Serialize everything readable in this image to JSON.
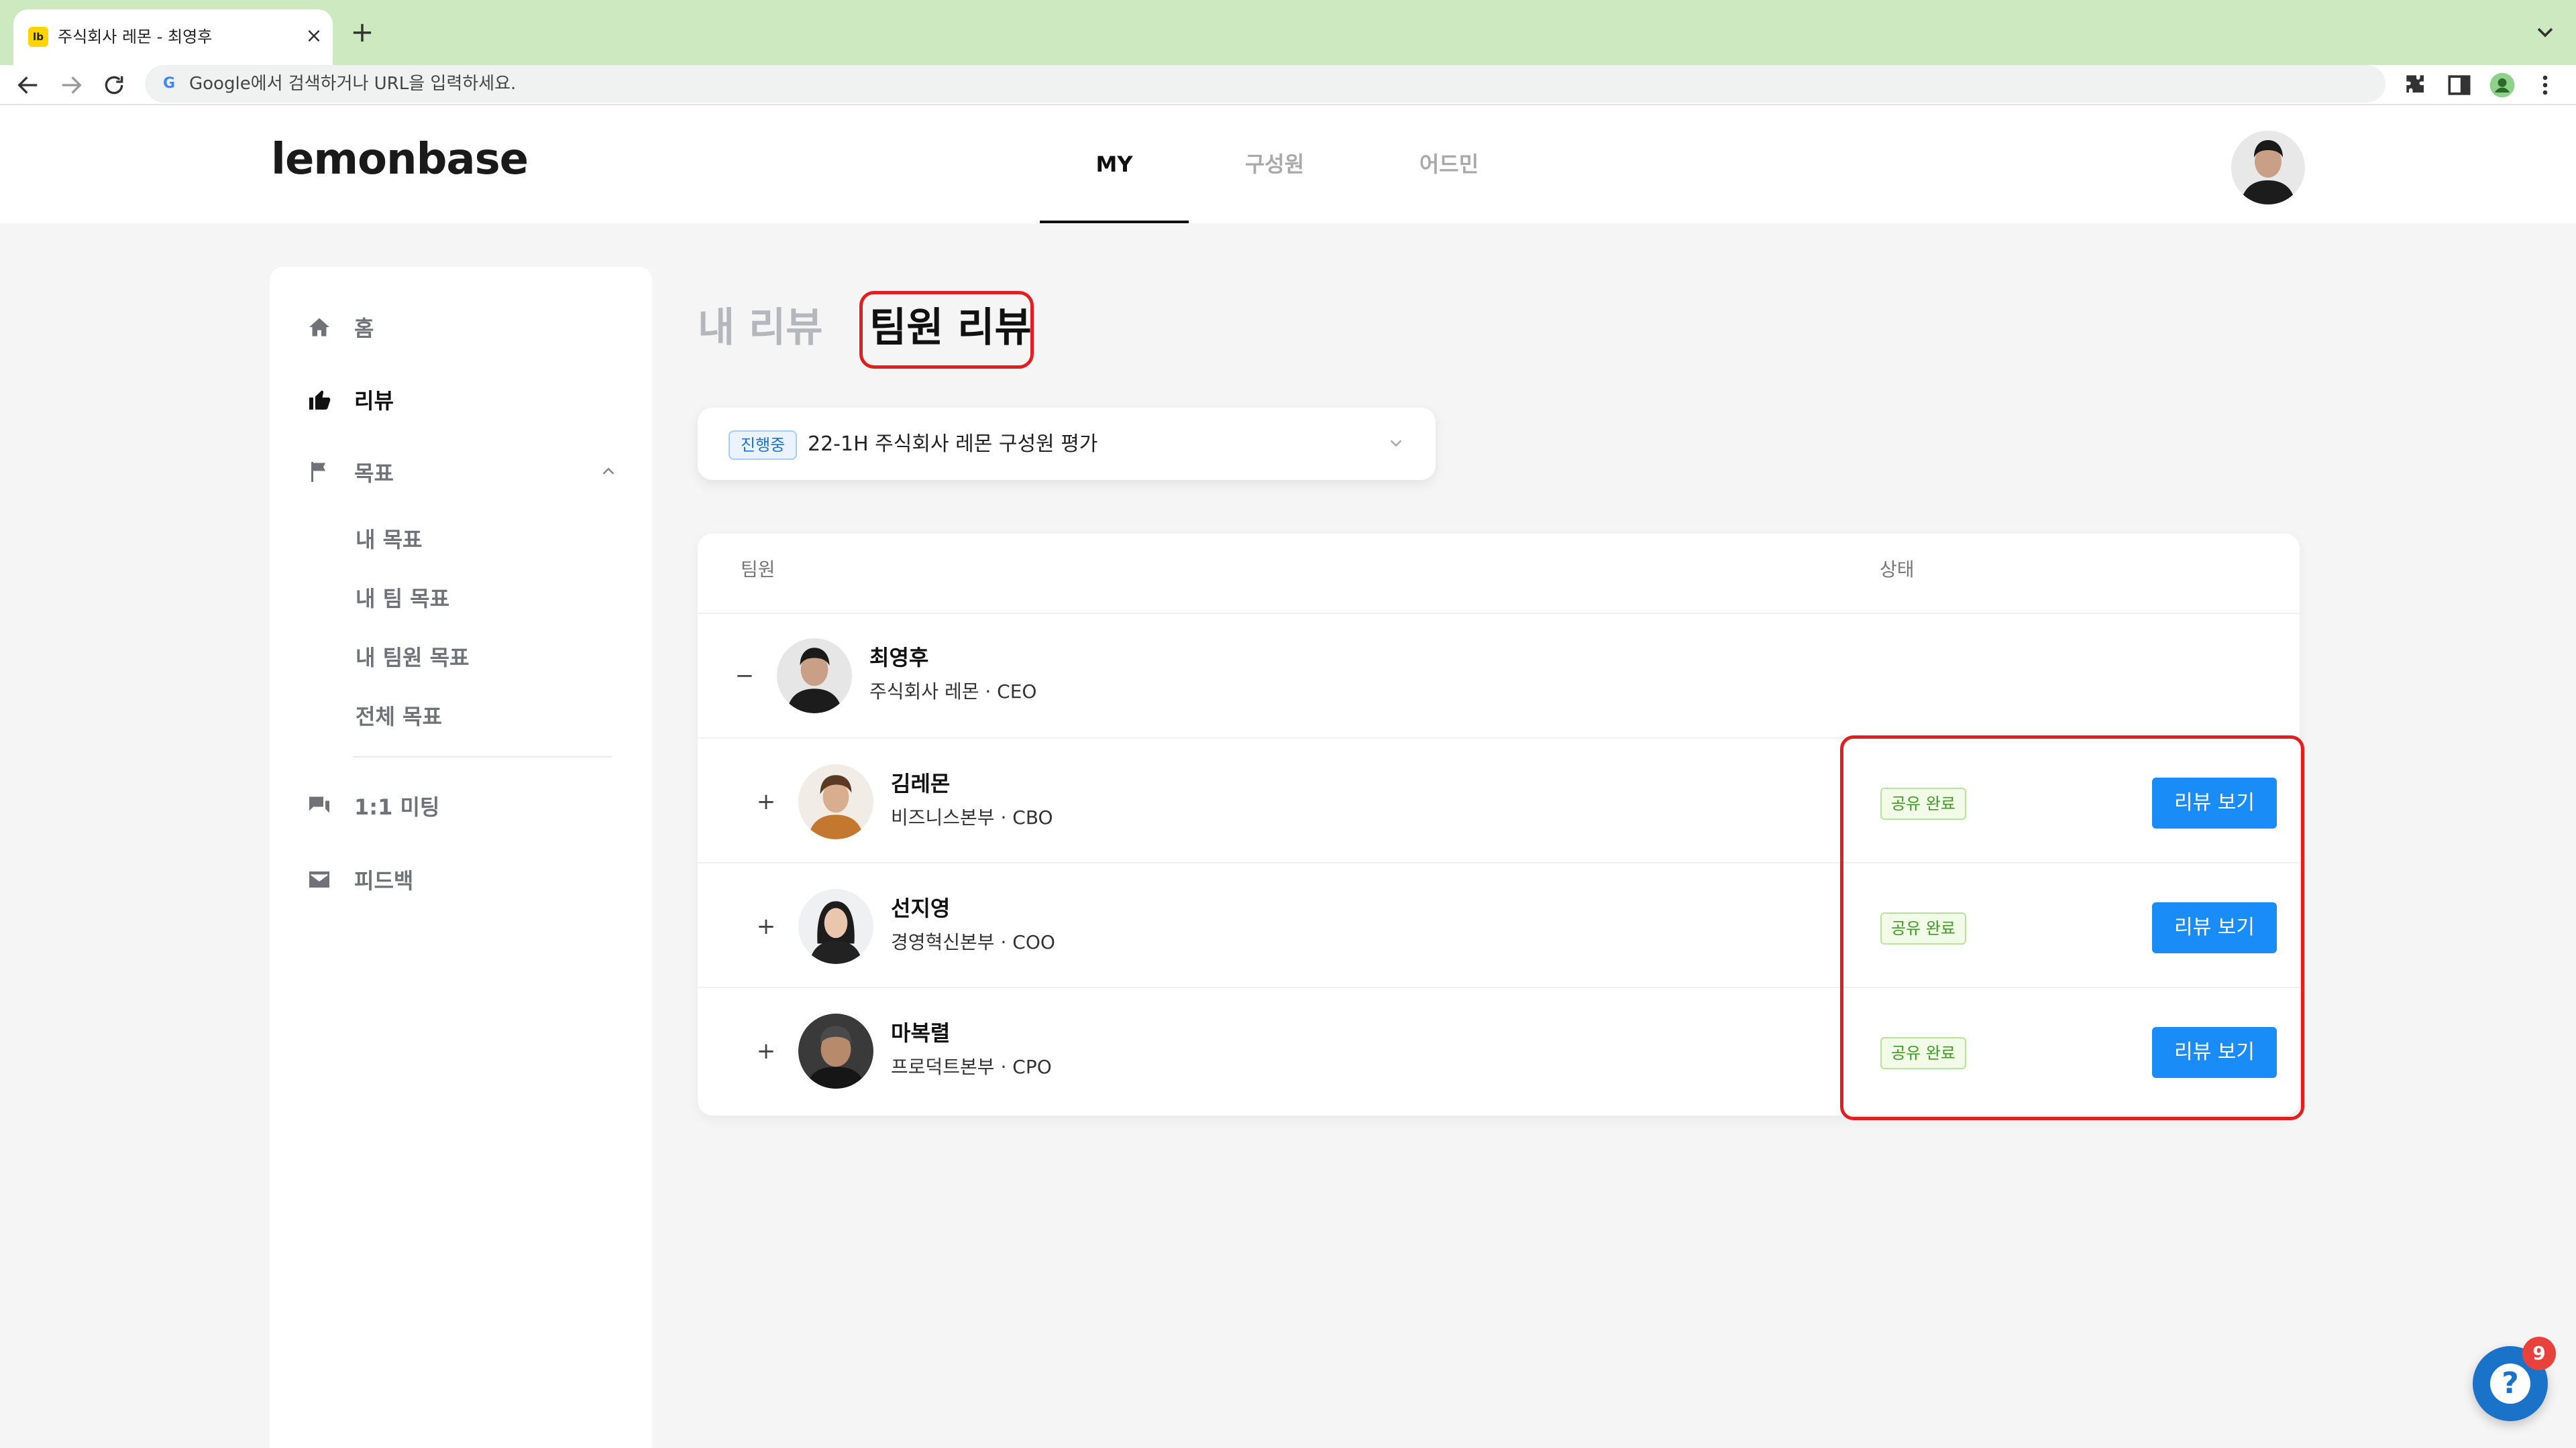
{
  "browser": {
    "tab_favicon": "lb",
    "tab_title": "주식회사 레몬 - 최영후",
    "tab_close": "×",
    "new_tab": "+",
    "address_placeholder": "Google에서 검색하거나 URL을 입력하세요."
  },
  "header": {
    "logo": "lemonbase",
    "nav": [
      {
        "label": "MY",
        "active": true
      },
      {
        "label": "구성원",
        "active": false
      },
      {
        "label": "어드민",
        "active": false
      }
    ]
  },
  "sidebar": {
    "items": [
      {
        "label": "홈",
        "icon": "home-icon"
      },
      {
        "label": "리뷰",
        "icon": "thumbs-up-icon",
        "active": true
      },
      {
        "label": "목표",
        "icon": "flag-icon",
        "expanded": true
      },
      {
        "label": "1:1 미팅",
        "icon": "chat-icon"
      },
      {
        "label": "피드백",
        "icon": "mail-icon"
      }
    ],
    "goal_subitems": [
      "내 목표",
      "내 팀 목표",
      "내 팀원 목표",
      "전체 목표"
    ]
  },
  "main": {
    "tabs": [
      "내 리뷰",
      "팀원 리뷰"
    ],
    "active_tab": "팀원 리뷰",
    "cycle": {
      "badge": "진행중",
      "label": "22-1H 주식회사 레몬 구성원 평가"
    },
    "table": {
      "headers": [
        "팀원",
        "상태"
      ],
      "rows": [
        {
          "toggle": "−",
          "name": "최영후",
          "title": "주식회사 레몬 · CEO",
          "status": "",
          "action": ""
        },
        {
          "toggle": "+",
          "name": "김레몬",
          "title": "비즈니스본부 · CBO",
          "status": "공유 완료",
          "action": "리뷰 보기"
        },
        {
          "toggle": "+",
          "name": "선지영",
          "title": "경영혁신본부 · COO",
          "status": "공유 완료",
          "action": "리뷰 보기"
        },
        {
          "toggle": "+",
          "name": "마복렬",
          "title": "프로덕트본부 · CPO",
          "status": "공유 완료",
          "action": "리뷰 보기"
        }
      ]
    }
  },
  "help": {
    "icon": "?",
    "badge": "9"
  },
  "colors": {
    "accent": "#1a8cf7",
    "highlight": "#e02020",
    "status_green": "#3f9a23"
  }
}
